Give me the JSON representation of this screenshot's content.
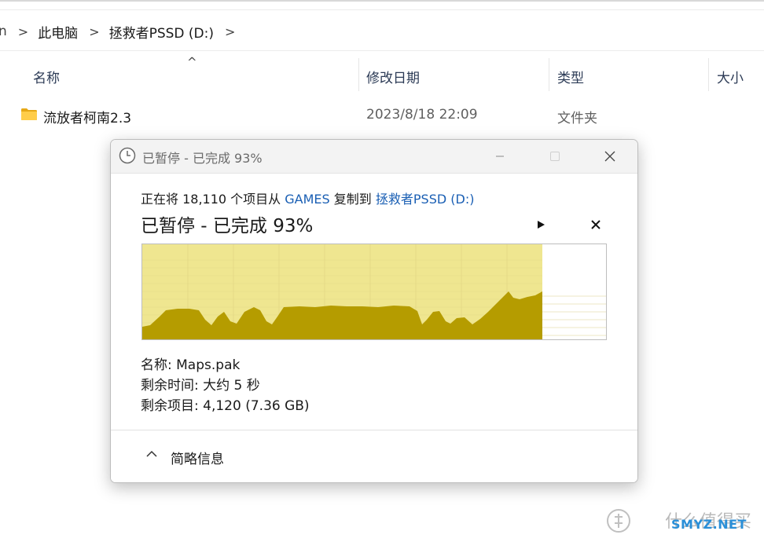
{
  "explorer": {
    "breadcrumb": {
      "cut_prefix": "n",
      "items": [
        "此电脑",
        "拯救者PSSD (D:)"
      ],
      "separator": ">"
    },
    "columns": {
      "name": "名称",
      "modified": "修改日期",
      "type": "类型",
      "size": "大小"
    },
    "rows": [
      {
        "name": "流放者柯南2.3",
        "modified": "2023/8/18 22:09",
        "type": "文件夹",
        "icon": "folder-icon"
      }
    ]
  },
  "dialog": {
    "title": "已暂停 - 已完成 93%",
    "copy_prefix": "正在将 18,110 个项目从",
    "source": "GAMES",
    "copy_mid": "复制到",
    "destination": "拯救者PSSD (D:)",
    "status": "已暂停 - 已完成 93%",
    "resume_icon": "play-icon",
    "cancel_icon": "close-icon",
    "progress_percent": 93,
    "graph_fill_color": "#b59c00",
    "graph_background_color": "#efe690",
    "name_label": "名称:",
    "name_value": "Maps.pak",
    "time_label": "剩余时间:",
    "time_value": "大约 5 秒",
    "items_label": "剩余项目:",
    "items_value": "4,120 (7.36 GB)",
    "less_details": "简略信息"
  },
  "watermark": {
    "text": "什么值得买",
    "site": "SMYZ.NET"
  }
}
